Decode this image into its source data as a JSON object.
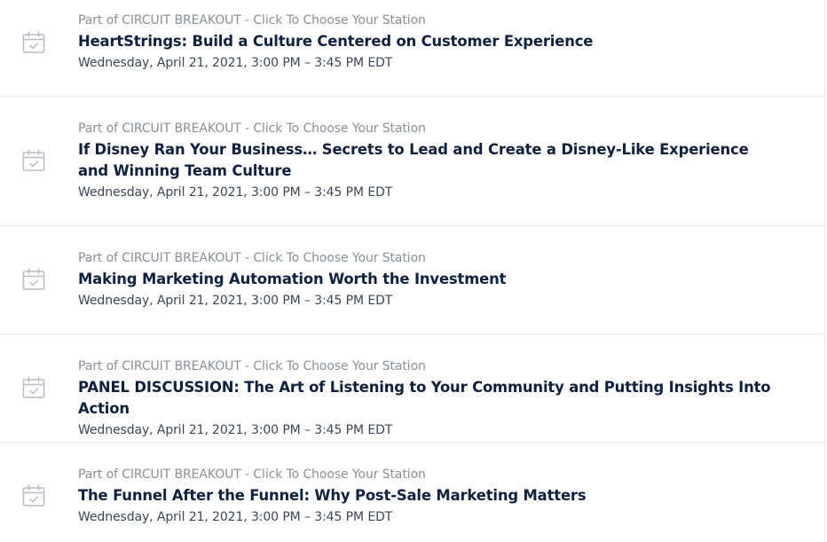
{
  "colors": {
    "parent_text": "#8a8f98",
    "title_text": "#11213d",
    "time_text": "#3d4657",
    "divider": "#e5e7eb",
    "icon_stroke": "#b7bcc4"
  },
  "sessions": [
    {
      "icon": "calendar-check-icon",
      "parent": "Part of CIRCUIT BREAKOUT - Click To Choose Your Station",
      "title": "HeartStrings: Build a Culture Centered on Customer Experience",
      "time": "Wednesday, April 21, 2021, 3:00 PM – 3:45 PM EDT"
    },
    {
      "icon": "calendar-check-icon",
      "parent": "Part of CIRCUIT BREAKOUT - Click To Choose Your Station",
      "title": "If Disney Ran Your Business… Secrets to Lead and Create a Disney-Like Experience and Winning Team Culture",
      "time": "Wednesday, April 21, 2021, 3:00 PM – 3:45 PM EDT"
    },
    {
      "icon": "calendar-check-icon",
      "parent": "Part of CIRCUIT BREAKOUT - Click To Choose Your Station",
      "title": "Making Marketing Automation Worth the Investment",
      "time": "Wednesday, April 21, 2021, 3:00 PM – 3:45 PM EDT"
    },
    {
      "icon": "calendar-check-icon",
      "parent": "Part of CIRCUIT BREAKOUT - Click To Choose Your Station",
      "title": "PANEL DISCUSSION: The Art of Listening to Your Community and Putting Insights Into Action",
      "time": "Wednesday, April 21, 2021, 3:00 PM – 3:45 PM EDT"
    },
    {
      "icon": "calendar-check-icon",
      "parent": "Part of CIRCUIT BREAKOUT - Click To Choose Your Station",
      "title": "The Funnel After the Funnel: Why Post-Sale Marketing Matters",
      "time": "Wednesday, April 21, 2021, 3:00 PM – 3:45 PM EDT"
    }
  ]
}
